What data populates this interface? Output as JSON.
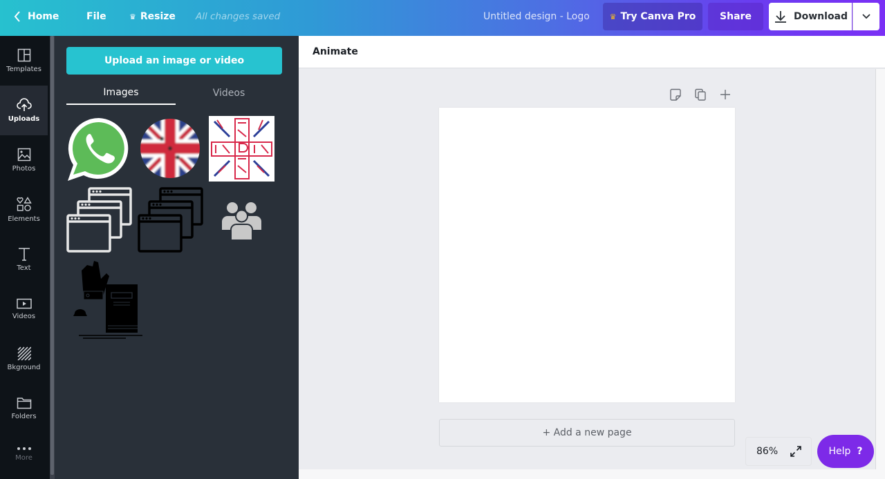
{
  "topbar": {
    "home_label": "Home",
    "file_label": "File",
    "resize_label": "Resize",
    "save_status": "All changes saved",
    "design_title": "Untitled design - Logo",
    "try_pro_label": "Try Canva Pro",
    "share_label": "Share",
    "download_label": "Download",
    "crown_icon": "♛"
  },
  "sidebar": {
    "items": [
      {
        "label": "Templates",
        "icon": "templates-icon"
      },
      {
        "label": "Uploads",
        "icon": "upload-cloud-icon",
        "active": true
      },
      {
        "label": "Photos",
        "icon": "photo-icon"
      },
      {
        "label": "Elements",
        "icon": "shapes-icon"
      },
      {
        "label": "Text",
        "icon": "text-icon"
      },
      {
        "label": "Videos",
        "icon": "video-icon"
      },
      {
        "label": "Bkground",
        "icon": "background-icon"
      },
      {
        "label": "Folders",
        "icon": "folder-icon"
      },
      {
        "label": "More",
        "icon": "more-icon"
      }
    ]
  },
  "panel": {
    "upload_button": "Upload an image or video",
    "tabs": [
      {
        "label": "Images",
        "active": true
      },
      {
        "label": "Videos",
        "active": false
      }
    ],
    "uploads": [
      {
        "name": "whatsapp-logo"
      },
      {
        "name": "union-jack-circle"
      },
      {
        "name": "union-jack-art"
      },
      {
        "name": "browser-windows-white"
      },
      {
        "name": "browser-windows-black"
      },
      {
        "name": "users-group"
      },
      {
        "name": "hand-book-illustration"
      }
    ]
  },
  "editor": {
    "animate_label": "Animate",
    "add_page_label": "+ Add a new page",
    "zoom_level": "86%",
    "help_label": "Help",
    "help_glyph": "?"
  },
  "colors": {
    "accent_teal": "#27c3d0",
    "pro_purple": "#7d2ae8",
    "sidebar_bg": "#0e1318",
    "panel_bg": "#293039"
  }
}
